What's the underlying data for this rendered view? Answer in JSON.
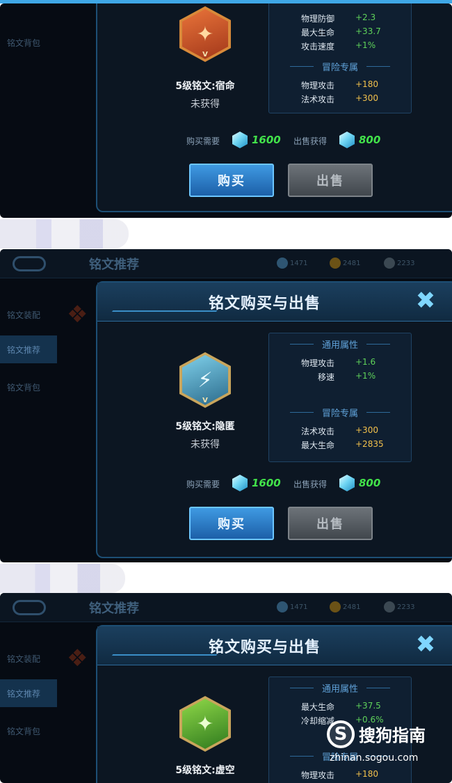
{
  "colors": {
    "accent": "#3fa7e6",
    "green": "#5fd35a",
    "gold": "#f2c14c",
    "price_green": "#42e24a"
  },
  "nav": {
    "title": "铭文推荐",
    "currencies": [
      "1471",
      "2481",
      "2233"
    ]
  },
  "side_menu": [
    "铭文装配",
    "铭文推荐",
    "铭文背包"
  ],
  "dialog": {
    "title": "铭文购买与出售",
    "close_icon": "close-x-icon",
    "general_title": "通用属性",
    "adventure_title": "冒险专属",
    "buy_cost_label": "购买需要",
    "sell_gain_label": "出售获得",
    "buy_label": "购买",
    "sell_label": "出售"
  },
  "runes": [
    {
      "name": "5级铭文:宿命",
      "status": "未获得",
      "level_mark": "V",
      "general": [
        {
          "name": "物理防御",
          "value": "+2.3"
        },
        {
          "name": "最大生命",
          "value": "+33.7"
        },
        {
          "name": "攻击速度",
          "value": "+1%"
        }
      ],
      "adventure": [
        {
          "name": "物理攻击",
          "value": "+180"
        },
        {
          "name": "法术攻击",
          "value": "+300"
        }
      ],
      "buy_price": "1600",
      "sell_price": "800"
    },
    {
      "name": "5级铭文:隐匿",
      "status": "未获得",
      "level_mark": "V",
      "general": [
        {
          "name": "物理攻击",
          "value": "+1.6"
        },
        {
          "name": "移速",
          "value": "+1%"
        }
      ],
      "adventure": [
        {
          "name": "法术攻击",
          "value": "+300"
        },
        {
          "name": "最大生命",
          "value": "+2835"
        }
      ],
      "buy_price": "1600",
      "sell_price": "800"
    },
    {
      "name": "5级铭文:虚空",
      "general": [
        {
          "name": "最大生命",
          "value": "+37.5"
        },
        {
          "name": "冷却缩减",
          "value": "+0.6%"
        }
      ],
      "adventure": [
        {
          "name": "物理攻击",
          "value": "+180"
        }
      ]
    }
  ],
  "watermark": {
    "name": "搜狗指南",
    "url": "zhinan.sogou.com"
  }
}
